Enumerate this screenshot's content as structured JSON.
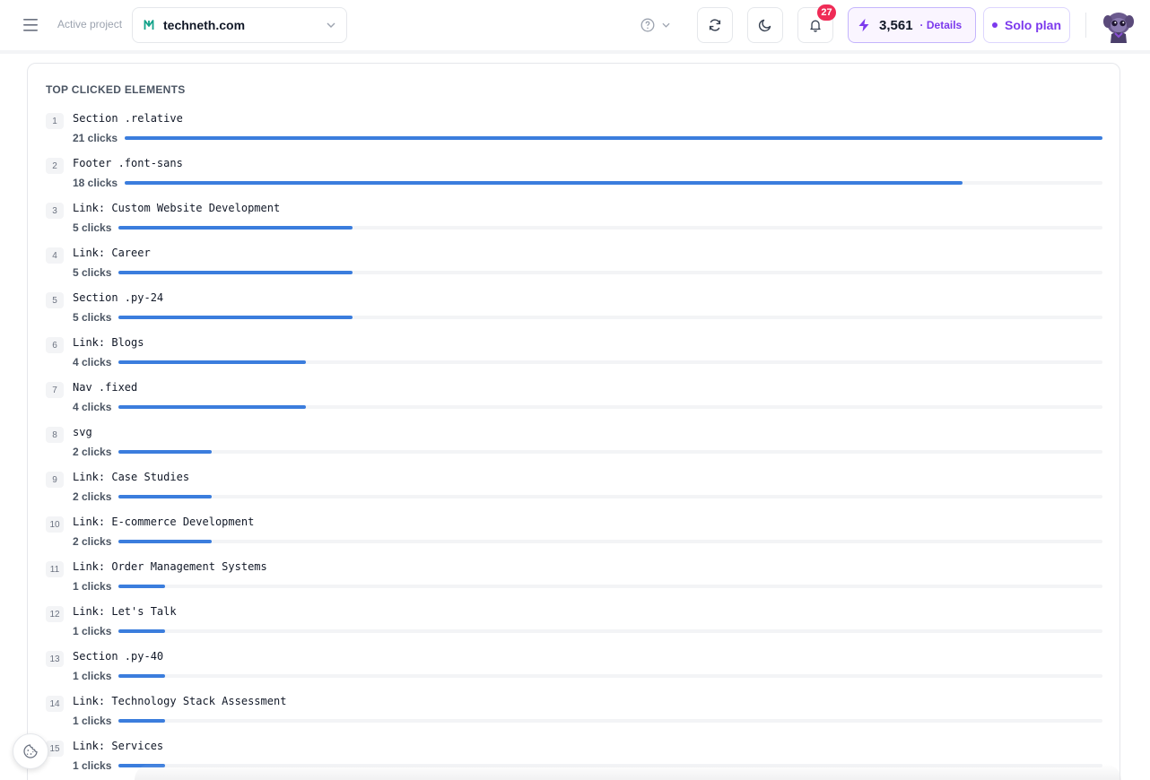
{
  "header": {
    "active_project_label": "Active project",
    "project_name": "techneth.com",
    "notifications_count": "27",
    "credits": "3,561",
    "credits_details": "· Details",
    "plan_label": "Solo plan",
    "accent_color": "#7c3aed"
  },
  "card": {
    "title": "TOP CLICKED ELEMENTS",
    "bar_color": "#3b7ddd",
    "max_clicks": 21,
    "items": [
      {
        "rank": "1",
        "name": "Section .relative",
        "clicks_label": "21 clicks",
        "clicks": 21
      },
      {
        "rank": "2",
        "name": "Footer .font-sans",
        "clicks_label": "18 clicks",
        "clicks": 18
      },
      {
        "rank": "3",
        "name": "Link: Custom Website Development",
        "clicks_label": "5 clicks",
        "clicks": 5
      },
      {
        "rank": "4",
        "name": "Link: Career",
        "clicks_label": "5 clicks",
        "clicks": 5
      },
      {
        "rank": "5",
        "name": "Section .py-24",
        "clicks_label": "5 clicks",
        "clicks": 5
      },
      {
        "rank": "6",
        "name": "Link: Blogs",
        "clicks_label": "4 clicks",
        "clicks": 4
      },
      {
        "rank": "7",
        "name": "Nav .fixed",
        "clicks_label": "4 clicks",
        "clicks": 4
      },
      {
        "rank": "8",
        "name": "svg",
        "clicks_label": "2 clicks",
        "clicks": 2
      },
      {
        "rank": "9",
        "name": "Link: Case Studies",
        "clicks_label": "2 clicks",
        "clicks": 2
      },
      {
        "rank": "10",
        "name": "Link: E-commerce Development",
        "clicks_label": "2 clicks",
        "clicks": 2
      },
      {
        "rank": "11",
        "name": "Link: Order Management Systems",
        "clicks_label": "1 clicks",
        "clicks": 1
      },
      {
        "rank": "12",
        "name": "Link: Let's Talk",
        "clicks_label": "1 clicks",
        "clicks": 1
      },
      {
        "rank": "13",
        "name": "Section .py-40",
        "clicks_label": "1 clicks",
        "clicks": 1
      },
      {
        "rank": "14",
        "name": "Link: Technology Stack Assessment",
        "clicks_label": "1 clicks",
        "clicks": 1
      },
      {
        "rank": "15",
        "name": "Link: Services",
        "clicks_label": "1 clicks",
        "clicks": 1
      }
    ]
  },
  "icons": {
    "menu": "hamburger-menu-icon",
    "project": "project-logo-icon",
    "help": "help-circle-icon",
    "refresh": "refresh-icon",
    "theme": "moon-icon",
    "notifications": "bell-icon",
    "credits": "lightning-bolt-icon",
    "cookie": "cookie-icon"
  }
}
